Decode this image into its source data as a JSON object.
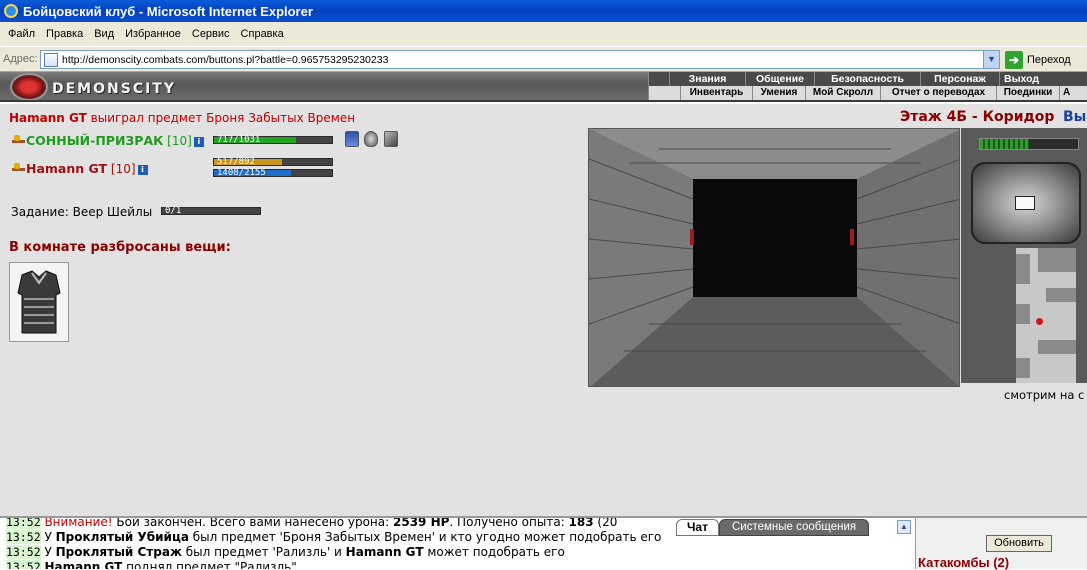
{
  "window": {
    "title": "Бойцовский клуб - Microsoft Internet Explorer"
  },
  "menu": [
    "Файл",
    "Правка",
    "Вид",
    "Избранное",
    "Сервис",
    "Справка"
  ],
  "address": {
    "label": "Адрес:",
    "url": "http://demonscity.combats.com/buttons.pl?battle=0.965753295230233",
    "go": "Переход"
  },
  "game": {
    "logo": "DEMONSCITY",
    "nav_top": [
      "Знания",
      "Общение",
      "Безопасность",
      "Персонаж",
      "Выход"
    ],
    "nav_bottom": [
      "Инвентарь",
      "Умения",
      "Мой Скролл",
      "Отчет о переводах",
      "Поединки",
      "А"
    ]
  },
  "notice": {
    "name": "Hamann GT",
    "text": " выиграл предмет Броня Забытых Времен"
  },
  "location": {
    "title": "Этаж 4Б - Коридор",
    "exit": "Вы"
  },
  "players": [
    {
      "name": "СОННЫЙ-ПРИЗРАК",
      "level": "[10]",
      "hp_text": "717/1031",
      "hp": 0.695
    },
    {
      "name": "Hamann GT",
      "level": "[10]",
      "hp_text": "517/892",
      "hp": 0.58,
      "mana_text": "1408/2155",
      "mana": 0.653
    }
  ],
  "task": {
    "label": "Задание: Веер Шейлы",
    "progress_text": "0/1",
    "progress": 0.0
  },
  "room": {
    "label": "В комнате разбросаны вещи:"
  },
  "map_caption": "смотрим на с",
  "chat": {
    "tabs": {
      "chat": "Чат",
      "system": "Системные сообщения"
    },
    "lines": [
      {
        "time": "13:52",
        "parts": [
          {
            "t": "Внимание!",
            "style": "warn"
          },
          {
            "t": " Бой закончен. Всего вами нанесено урона: "
          },
          {
            "t": "2539 HP",
            "style": "b"
          },
          {
            "t": ". Получено опыта: "
          },
          {
            "t": "183",
            "style": "b"
          },
          {
            "t": " (20"
          }
        ]
      },
      {
        "time": "13:52",
        "parts": [
          {
            "t": "У "
          },
          {
            "t": "Проклятый Убийца",
            "style": "b"
          },
          {
            "t": " был предмет 'Броня Забытых Времен' и кто угодно может подобрать его"
          }
        ]
      },
      {
        "time": "13:52",
        "parts": [
          {
            "t": "У "
          },
          {
            "t": "Проклятый Страж",
            "style": "b"
          },
          {
            "t": " был предмет 'Рализль' и "
          },
          {
            "t": "Hamann GT",
            "style": "b"
          },
          {
            "t": " может подобрать его"
          }
        ]
      },
      {
        "time": "13:52",
        "parts": [
          {
            "t": "Hamann GT",
            "style": "b"
          },
          {
            "t": " поднял предмет \"Рализль\""
          }
        ]
      }
    ]
  },
  "right_panel": {
    "refresh": "Обновить",
    "location": "Катакомбы (2)"
  },
  "colors": {
    "accent_red": "#8b0000",
    "player_green": "#1f9a1f",
    "hp_green": "#23a523",
    "hp_orange": "#c8961a",
    "mana_blue": "#1d6fc8"
  }
}
